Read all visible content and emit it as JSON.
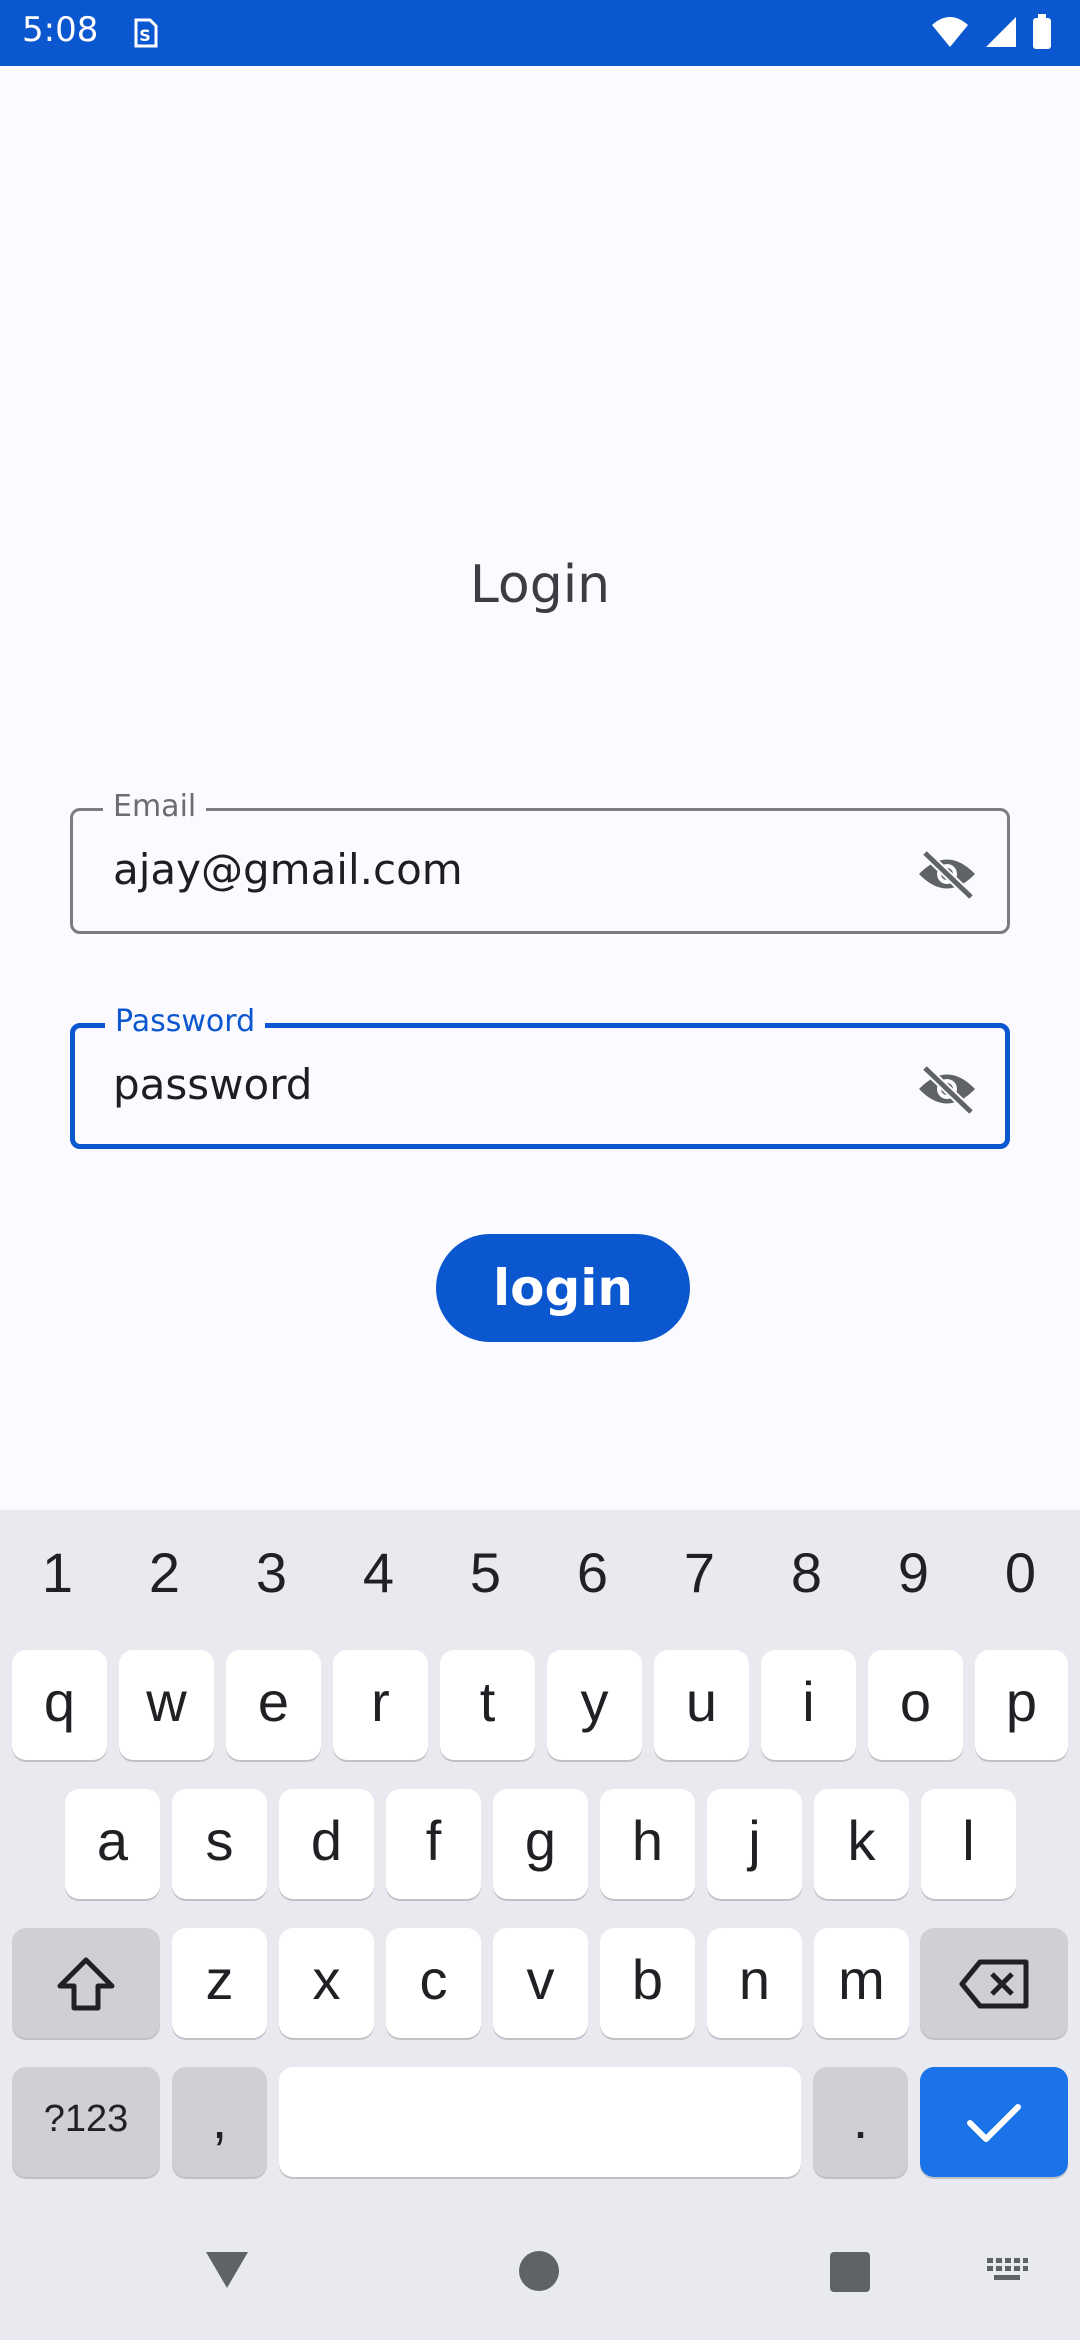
{
  "status_bar": {
    "time": "5:08",
    "icons": [
      "sim-icon",
      "wifi-icon",
      "signal-icon",
      "battery-icon"
    ]
  },
  "login_form": {
    "title": "Login",
    "email": {
      "label": "Email",
      "value": "ajay@gmail.com"
    },
    "password": {
      "label": "Password",
      "value": "password"
    },
    "submit_label": "login"
  },
  "keyboard": {
    "number_row": [
      "1",
      "2",
      "3",
      "4",
      "5",
      "6",
      "7",
      "8",
      "9",
      "0"
    ],
    "row1": [
      "q",
      "w",
      "e",
      "r",
      "t",
      "y",
      "u",
      "i",
      "o",
      "p"
    ],
    "row2": [
      "a",
      "s",
      "d",
      "f",
      "g",
      "h",
      "j",
      "k",
      "l"
    ],
    "row3": [
      "z",
      "x",
      "c",
      "v",
      "b",
      "n",
      "m"
    ],
    "symbols_key": "?123",
    "comma_key": ",",
    "period_key": "."
  },
  "nav_bar": {
    "icons": [
      "back-icon",
      "home-icon",
      "recents-icon",
      "keyboard-switch-icon"
    ]
  },
  "colors": {
    "accent": "#0b57d0",
    "background": "#fbfafe",
    "keyboard_background": "#e9eaef",
    "enter_key": "#1a73e8"
  }
}
